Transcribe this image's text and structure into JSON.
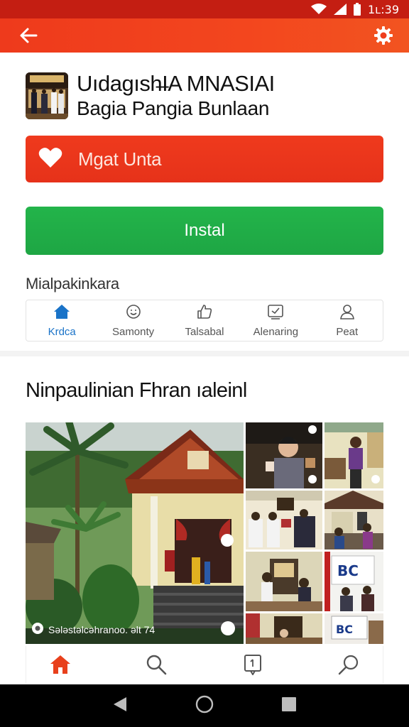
{
  "status_bar": {
    "time": "1ʟ:39"
  },
  "app": {
    "title": "Uıdagısh̶IA MNASIAI",
    "subtitle": "Bagia Pangia Bunlaan"
  },
  "actions": {
    "wishlist_label": "Mgat Unta",
    "install_label": "Instal"
  },
  "categories": {
    "heading": "Mialpakinkara",
    "tabs": [
      {
        "label": "Krdca",
        "icon": "home-icon",
        "active": true
      },
      {
        "label": "Samonty",
        "icon": "smile-icon",
        "active": false
      },
      {
        "label": "Talsabal",
        "icon": "thumbs-up-icon",
        "active": false
      },
      {
        "label": "Alenaring",
        "icon": "check-box-icon",
        "active": false
      },
      {
        "label": "Peat",
        "icon": "person-icon",
        "active": false
      }
    ]
  },
  "gallery": {
    "title": "Ninpaulinian Fhran ıaleinl",
    "main_caption": "Sələstəlcəhranoo. əlt 74"
  },
  "colors": {
    "status_bar": "#c41e12",
    "app_bar": "#ef3d1c",
    "wishlist": "#ea351b",
    "install": "#21ad47",
    "active_tab": "#1a73c8",
    "nav_home": "#e8401c"
  },
  "bottom_nav": [
    "home-icon",
    "search-icon",
    "bookmark-icon",
    "search-alt-icon"
  ],
  "system_nav": [
    "back-icon",
    "home-circle-icon",
    "recents-icon"
  ]
}
